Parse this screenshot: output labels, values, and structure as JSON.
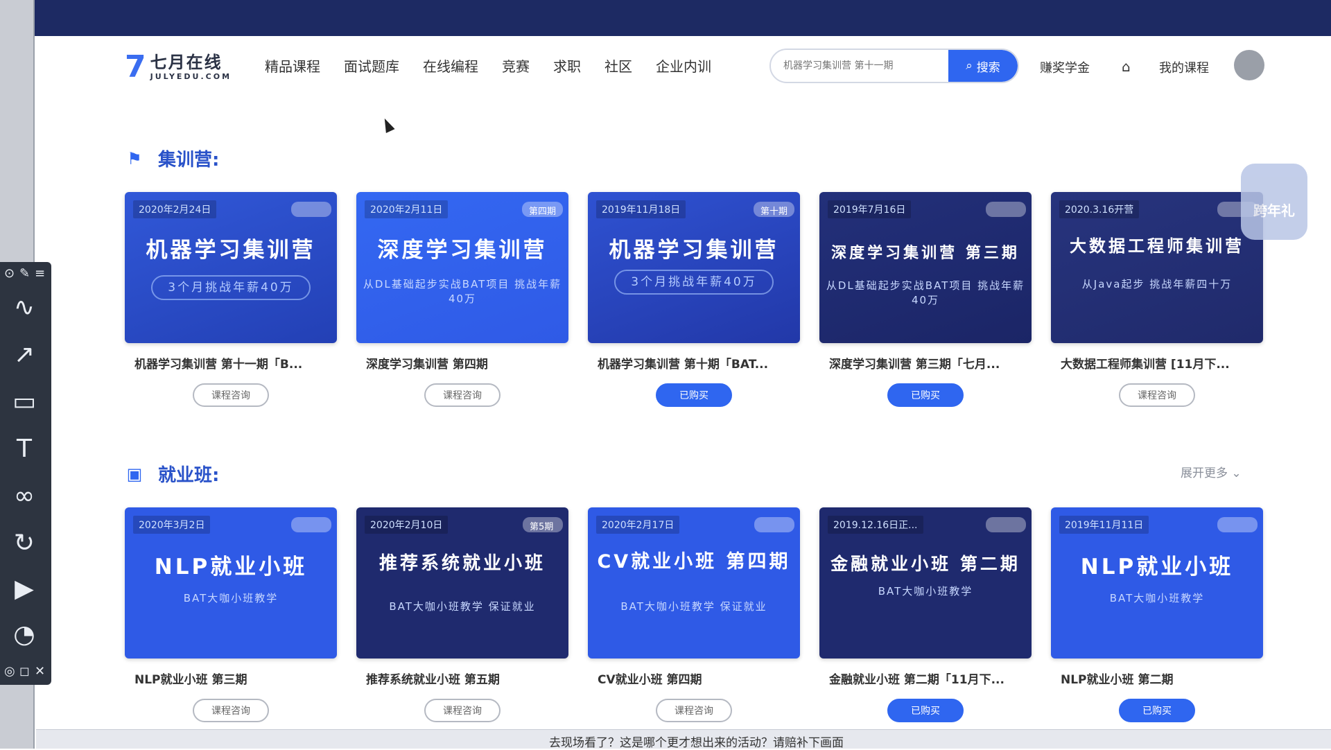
{
  "logo": {
    "mark": "7",
    "cn": "七月在线",
    "en": "JULYEDU.COM"
  },
  "nav": {
    "links": [
      "精品课程",
      "面试题库",
      "在线编程",
      "竞赛",
      "求职",
      "社区",
      "企业内训"
    ],
    "search_placeholder": "机器学习集训营 第十一期",
    "search_button": "搜索",
    "scholarship": "赚奖学金",
    "my_courses": "我的课程"
  },
  "sections": {
    "camp": {
      "title": "集训营:"
    },
    "jobs": {
      "title": "就业班:",
      "more": "展开更多"
    }
  },
  "camp_cards": [
    {
      "date": "2020年2月24日",
      "badge": "",
      "big": "机器学习集训营",
      "sub": "3个月挑战年薪40万",
      "title": "机器学习集训营 第十一期「B...",
      "button": "课程咨询",
      "bought": false
    },
    {
      "date": "2020年2月11日",
      "badge": "第四期",
      "big": "深度学习集训营",
      "sub": "从DL基础起步实战BAT项目 挑战年薪40万",
      "title": "深度学习集训营 第四期",
      "button": "课程咨询",
      "bought": false
    },
    {
      "date": "2019年11月18日",
      "badge": "第十期",
      "big": "机器学习集训营",
      "sub": "3个月挑战年薪40万",
      "title": "机器学习集训营 第十期「BAT...",
      "button": "已购买",
      "bought": true
    },
    {
      "date": "2019年7月16日",
      "badge": "",
      "big": "深度学习集训营 第三期",
      "sub": "从DL基础起步实战BAT项目 挑战年薪40万",
      "title": "深度学习集训营 第三期「七月...",
      "button": "已购买",
      "bought": true
    },
    {
      "date": "2020.3.16开营",
      "badge": "",
      "big": "大数据工程师集训营",
      "sub": "从Java起步 挑战年薪四十万",
      "title": "大数据工程师集训营 [11月下...",
      "button": "课程咨询",
      "bought": false
    }
  ],
  "job_cards": [
    {
      "date": "2020年3月2日",
      "badge": "",
      "big": "NLP就业小班",
      "sub": "BAT大咖小班教学",
      "title": "NLP就业小班 第三期",
      "button": "课程咨询",
      "bought": false
    },
    {
      "date": "2020年2月10日",
      "badge": "第5期",
      "big": "推荐系统就业小班",
      "sub": "BAT大咖小班教学 保证就业",
      "title": "推荐系统就业小班 第五期",
      "button": "课程咨询",
      "bought": false
    },
    {
      "date": "2020年2月17日",
      "badge": "",
      "big": "CV就业小班 第四期",
      "sub": "BAT大咖小班教学 保证就业",
      "title": "CV就业小班 第四期",
      "button": "课程咨询",
      "bought": false
    },
    {
      "date": "2019.12.16日正...",
      "badge": "",
      "big": "金融就业小班 第二期",
      "sub": "BAT大咖小班教学",
      "title": "金融就业小班 第二期「11月下...",
      "button": "已购买",
      "bought": true
    },
    {
      "date": "2019年11月11日",
      "badge": "",
      "big": "NLP就业小班",
      "sub": "BAT大咖小班教学",
      "title": "NLP就业小班 第二期",
      "button": "已购买",
      "bought": true
    }
  ],
  "float_badge": "跨年礼",
  "bottom_text": "去现场看了？这是哪个更才想出来的活动？请赔补下画面",
  "colors": {
    "accent": "#2f66f0",
    "dark_card": "#1f2a6e",
    "mid_card": "#2a4bd8",
    "topbar": "#1d2a63"
  }
}
